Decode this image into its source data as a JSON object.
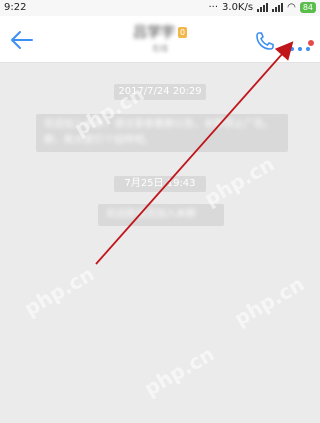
{
  "status_bar": {
    "time": "9:22",
    "speed": "3.0K/s",
    "battery": "84"
  },
  "header": {
    "title": "吕学宇",
    "badge": "0",
    "subtitle": "在线"
  },
  "messages": {
    "timestamp_1": "2017/7/24 20:29",
    "system_1_line1": "欢迎加入本群，请注意查看群公告，本群禁止广告。",
    "system_1_line2": "群，和大家打个招呼吧。",
    "timestamp_2": "7月25日 19:43",
    "system_2": "欢迎新成员加入本群"
  },
  "watermark": "php.cn",
  "colors": {
    "accent": "#3d8ff2",
    "notification": "#e84a4a",
    "annotation_arrow": "#c0151b",
    "bubble": "#d9d9d9"
  },
  "icons": {
    "back": "arrow-left-icon",
    "phone": "phone-icon",
    "more": "more-dots-icon"
  }
}
